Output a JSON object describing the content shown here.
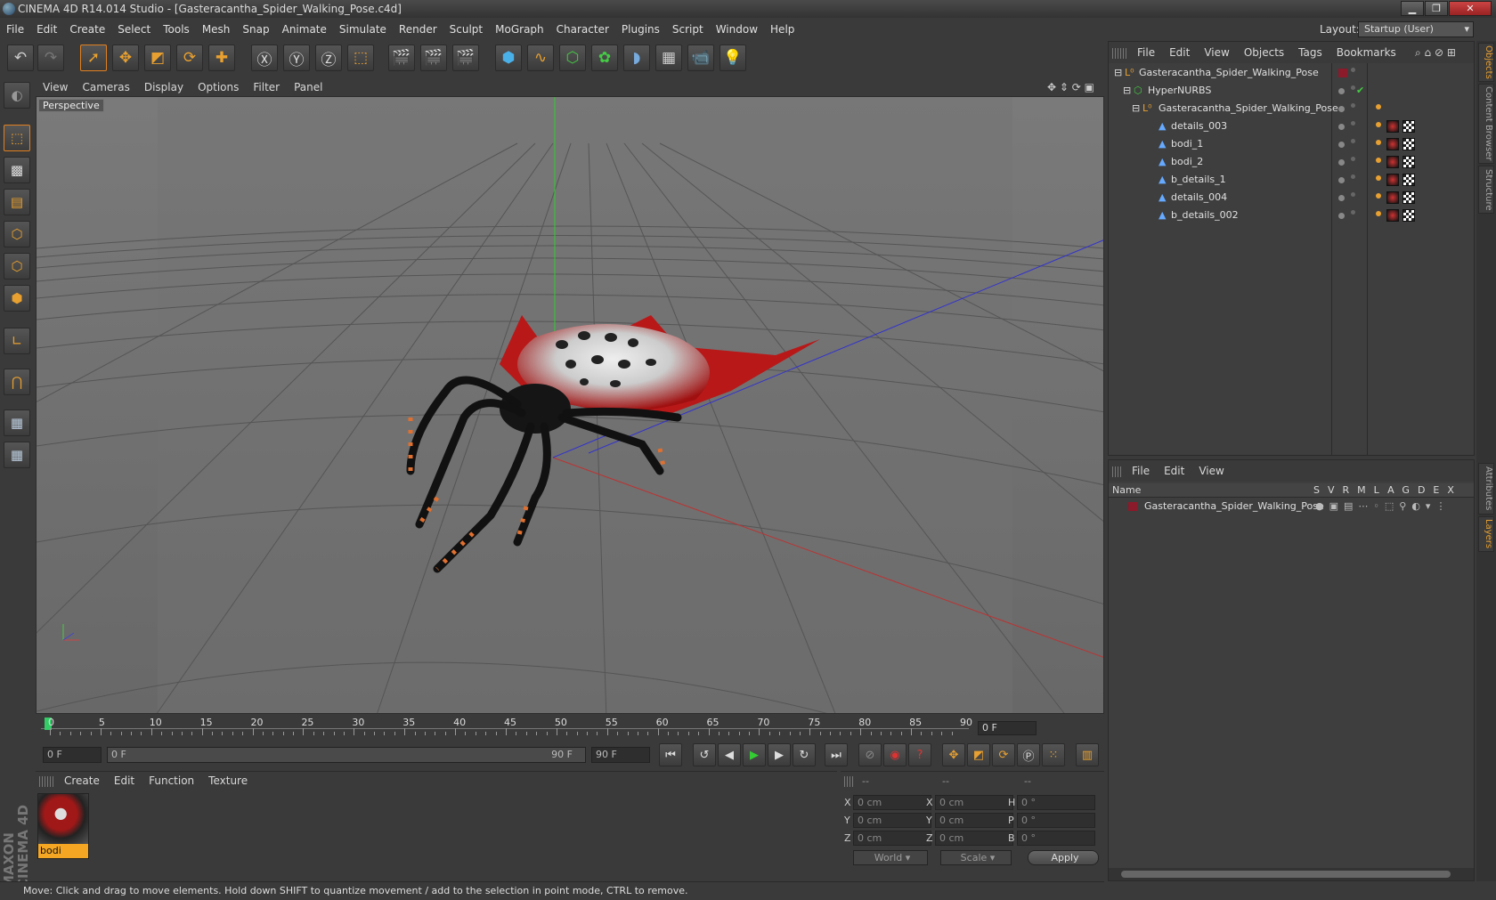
{
  "window": {
    "title": "CINEMA 4D R14.014 Studio - [Gasteracantha_Spider_Walking_Pose.c4d]"
  },
  "menu": [
    "File",
    "Edit",
    "Create",
    "Select",
    "Tools",
    "Mesh",
    "Snap",
    "Animate",
    "Simulate",
    "Render",
    "Sculpt",
    "MoGraph",
    "Character",
    "Plugins",
    "Script",
    "Window",
    "Help"
  ],
  "layout": {
    "label": "Layout:",
    "value": "Startup (User)"
  },
  "viewport": {
    "menu": [
      "View",
      "Cameras",
      "Display",
      "Options",
      "Filter",
      "Panel"
    ],
    "label": "Perspective"
  },
  "timeline": {
    "ticks": [
      "0",
      "5",
      "10",
      "15",
      "20",
      "25",
      "30",
      "35",
      "40",
      "45",
      "50",
      "55",
      "60",
      "65",
      "70",
      "75",
      "80",
      "85",
      "90"
    ],
    "frame_display": "0 F"
  },
  "transport": {
    "start": "0 F",
    "range_start": "0 F",
    "range_end": "90 F",
    "end": "90 F"
  },
  "material_panel": {
    "menu": [
      "Create",
      "Edit",
      "Function",
      "Texture"
    ],
    "material_name": "bodi"
  },
  "coords": {
    "headers": [
      "--",
      "--",
      "--"
    ],
    "rows": [
      {
        "l1": "X",
        "v1": "0 cm",
        "l2": "X",
        "v2": "0 cm",
        "l3": "H",
        "v3": "0 °"
      },
      {
        "l1": "Y",
        "v1": "0 cm",
        "l2": "Y",
        "v2": "0 cm",
        "l3": "P",
        "v3": "0 °"
      },
      {
        "l1": "Z",
        "v1": "0 cm",
        "l2": "Z",
        "v2": "0 cm",
        "l3": "B",
        "v3": "0 °"
      }
    ],
    "mode1": "World",
    "mode2": "Scale",
    "apply": "Apply"
  },
  "status": "Move: Click and drag to move elements. Hold down SHIFT to quantize movement / add to the selection in point mode, CTRL to remove.",
  "objects_panel": {
    "menu": [
      "File",
      "Edit",
      "View",
      "Objects",
      "Tags",
      "Bookmarks"
    ],
    "items": [
      {
        "name": "Gasteracantha_Spider_Walking_Pose",
        "indent": 0
      },
      {
        "name": "HyperNURBS",
        "indent": 1
      },
      {
        "name": "Gasteracantha_Spider_Walking_Pose",
        "indent": 2
      },
      {
        "name": "details_003",
        "indent": 3
      },
      {
        "name": "bodi_1",
        "indent": 3
      },
      {
        "name": "bodi_2",
        "indent": 3
      },
      {
        "name": "b_details_1",
        "indent": 3
      },
      {
        "name": "details_004",
        "indent": 3
      },
      {
        "name": "b_details_002",
        "indent": 3
      }
    ]
  },
  "layers_panel": {
    "menu": [
      "File",
      "Edit",
      "View"
    ],
    "header": "Name",
    "cols": [
      "S",
      "V",
      "R",
      "M",
      "L",
      "A",
      "G",
      "D",
      "E",
      "X"
    ],
    "item": "Gasteracantha_Spider_Walking_Pose"
  },
  "side_tabs": [
    "Objects",
    "Content Browser",
    "Structure",
    "Attributes",
    "Layers"
  ],
  "brand": "MAXON CINEMA 4D",
  "colors": {
    "accent": "#e8a030",
    "layer": "#8b1a2a"
  }
}
